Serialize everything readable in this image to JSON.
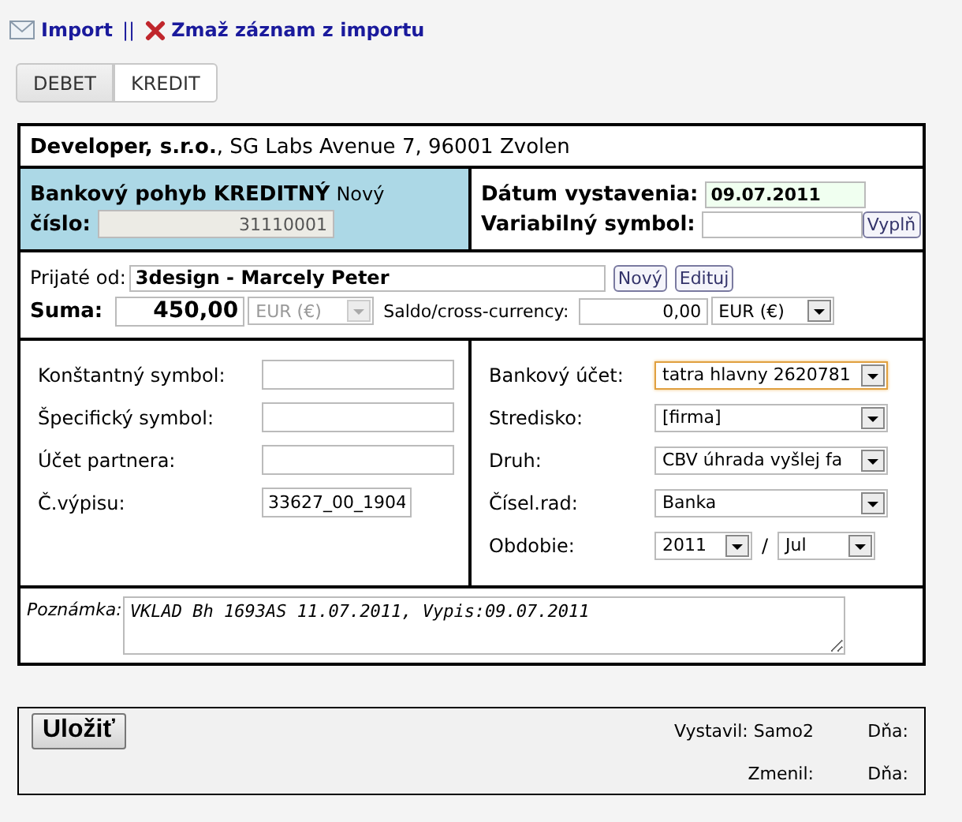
{
  "header_links": [
    {
      "kind": "mail",
      "label": "Import"
    },
    {
      "kind": "delete",
      "label": "Zmaž záznam z importu"
    }
  ],
  "separator": "||",
  "tabs": [
    {
      "label": "DEBET",
      "selected": false
    },
    {
      "label": "KREDIT",
      "selected": true
    }
  ],
  "company": {
    "name": "Developer, s.r.o.",
    "address": ", SG Labs Avenue 7, 96001 Zvolen"
  },
  "record": {
    "title": "Bankový pohyb KREDITNÝ",
    "status": "Nový",
    "number_label": "číslo:",
    "number": "31110001"
  },
  "dates": {
    "issue_label": "Dátum vystavenia:",
    "issue": "09.07.2011",
    "vs_label": "Variabilný symbol:",
    "vs_button": "Vyplň"
  },
  "payer": {
    "label": "Prijaté od:",
    "value": "3design - Marcely Peter",
    "buttons": [
      "Nový",
      "Edituj"
    ]
  },
  "amount": {
    "label": "Suma:",
    "value": "450,00",
    "currency": "EUR (€)",
    "currency_disabled": true,
    "saldo_label": "Saldo/cross-currency:",
    "saldo": "0,00",
    "saldo_currency": "EUR (€)"
  },
  "left_fields": [
    {
      "label": "Konštantný symbol:"
    },
    {
      "label": "Špecifický symbol:"
    },
    {
      "label": "Účet partnera:"
    },
    {
      "label": "Č.výpisu:",
      "value": "33627_00_1904"
    }
  ],
  "right_fields": [
    {
      "kind": "select",
      "label": "Bankový účet:",
      "value": "tatra hlavny 2620781",
      "focused": true
    },
    {
      "kind": "select",
      "label": "Stredisko:",
      "value": "[firma]",
      "focused": false
    },
    {
      "kind": "select",
      "label": "Druh:",
      "value": "CBV úhrada vyšlej fa",
      "focused": false
    },
    {
      "kind": "select",
      "label": "Čísel.rad:",
      "value": "Banka",
      "focused": false
    },
    {
      "kind": "period",
      "label": "Obdobie:",
      "values": [
        "2011",
        "Jul"
      ],
      "separator": "/"
    }
  ],
  "note": {
    "label": "Poznámka:",
    "value": "VKLAD Bh 1693AS 11.07.2011, Vypis:09.07.2011"
  },
  "footer": {
    "save": "Uložiť",
    "created": "Vystavil: Samo2",
    "created_day": "Dňa:",
    "changed": "Zmenil:",
    "changed_day": "Dňa:"
  }
}
